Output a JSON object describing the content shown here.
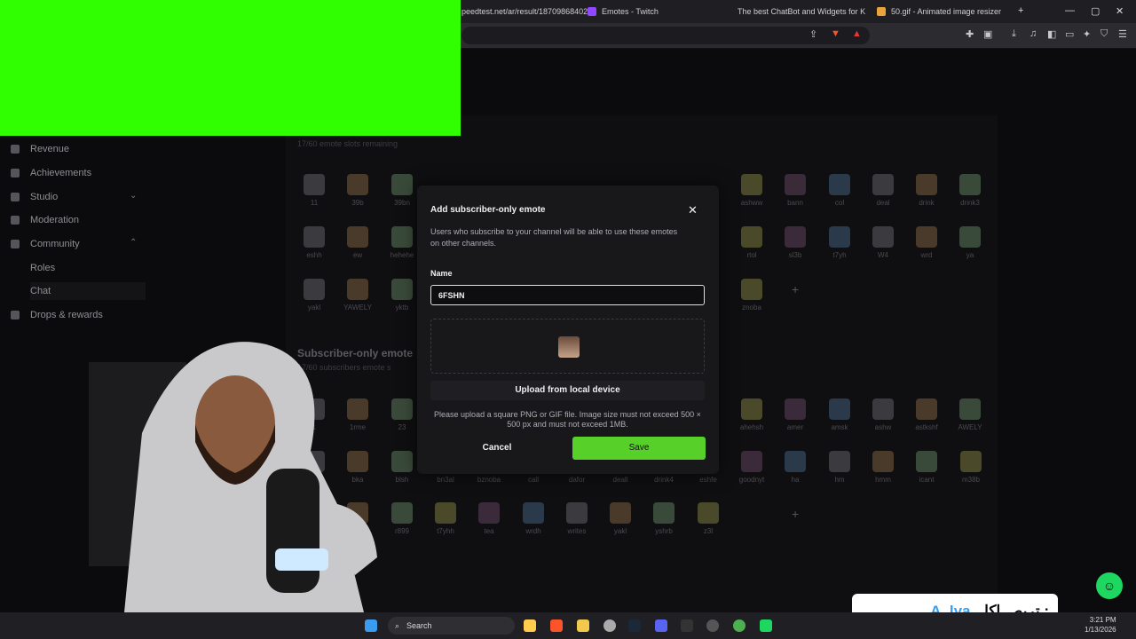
{
  "browser": {
    "tabs": [
      {
        "label": "peedtest.net/ar/result/18709868402",
        "color": "#3b6ea5"
      },
      {
        "label": "Emotes - Twitch",
        "color": "#9146ff"
      },
      {
        "label": "The best ChatBot and Widgets for Ki",
        "color": "#dddddd"
      },
      {
        "label": "50.gif - Animated image resizer",
        "color": "#e8a33a"
      }
    ]
  },
  "sidebar": {
    "items": [
      {
        "label": "Revenue",
        "icon": "revenue-icon"
      },
      {
        "label": "Achievements",
        "icon": "trophy-icon"
      },
      {
        "label": "Studio",
        "icon": "studio-icon"
      },
      {
        "label": "Moderation",
        "icon": "sword-icon"
      },
      {
        "label": "Community",
        "icon": "community-icon"
      },
      {
        "label": "Roles"
      },
      {
        "label": "Chat"
      },
      {
        "label": "Drops & rewards",
        "icon": "gift-icon"
      }
    ]
  },
  "main": {
    "emote_slots": "17/60 emote slots remaining",
    "sub_section_title": "Subscriber-only emote",
    "sub_slots": "17/60 subscribers emote s",
    "row1": [
      "11",
      "39b",
      "39bn",
      "ashww",
      "bann",
      "col",
      "deal",
      "drink",
      "drink3"
    ],
    "row2": [
      "eshh",
      "ew",
      "hehehe",
      "rtol",
      "sl3b",
      "t7yh",
      "W4",
      "wrd",
      "ya"
    ],
    "row3": [
      "yakl",
      "YAWELY",
      "yktb",
      "znoba"
    ],
    "sub_row1": [
      "1",
      "1rme",
      "23",
      "ahehsh",
      "amer",
      "amsk",
      "ashw",
      "astkshf",
      "AWELY"
    ],
    "sub_row2": [
      "han",
      "bka",
      "blsh",
      "bn3al",
      "bznoba",
      "call",
      "dafor",
      "deall",
      "drink4",
      "eshfe",
      "goodnyt",
      "ha",
      "hm",
      "hmm",
      "icant",
      "m38b"
    ],
    "sub_row3": [
      "nsm",
      "okk",
      "r899",
      "t7yhh",
      "tea",
      "wrdh",
      "writes",
      "yakl",
      "yshrb",
      "z3l"
    ]
  },
  "modal": {
    "title": "Add subscriber-only emote",
    "description": "Users who subscribe to your channel will be able to use these emotes on other channels.",
    "name_label": "Name",
    "name_value": "6FSHN",
    "upload_label": "Upload from local device",
    "help_text": "Please upload a square PNG or GIF file. Image size must not exceed 500 × 500 px and must not exceed 1MB.",
    "cancel_label": "Cancel",
    "save_label": "Save",
    "save_color": "#57d12a"
  },
  "overlay": {
    "banner_user": "A_lya",
    "banner_text": "تربص اكل :"
  },
  "taskbar": {
    "search_label": "Search",
    "time": "3:21 PM",
    "date": "1/13/2026"
  }
}
